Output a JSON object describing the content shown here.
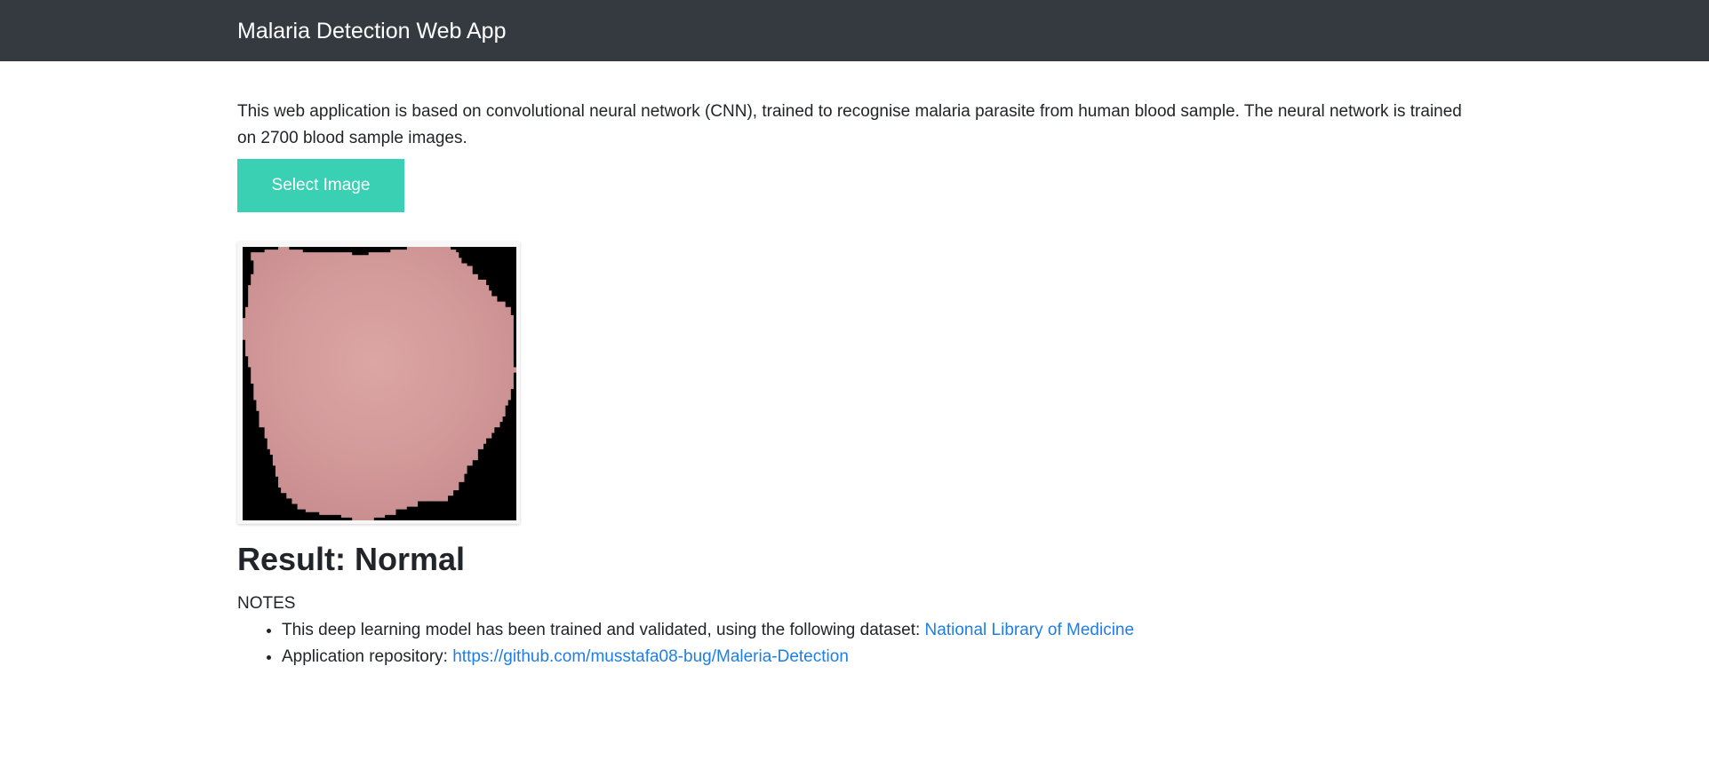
{
  "navbar": {
    "brand": "Malaria Detection Web App"
  },
  "main": {
    "intro_text": "This web application is based on convolutional neural network (CNN), trained to recognise malaria parasite from human blood sample. The neural network is trained on 2700 blood sample images.",
    "select_button_label": "Select Image",
    "preview_image": {
      "icon": "blood-cell-image",
      "cell_color": "#d39a9a",
      "background_color": "#000000"
    },
    "result_text": "Result: Normal",
    "notes_label": "NOTES",
    "notes": [
      {
        "text": "This deep learning model has been trained and validated, using the following dataset: ",
        "link_text": "National Library of Medicine"
      },
      {
        "text": "Application repository: ",
        "link_text": "https://github.com/musstafa08-bug/Maleria-Detection"
      }
    ]
  },
  "colors": {
    "navbar_bg": "#343a40",
    "button_bg": "#3ad0b3",
    "link": "#1e7ee8"
  }
}
